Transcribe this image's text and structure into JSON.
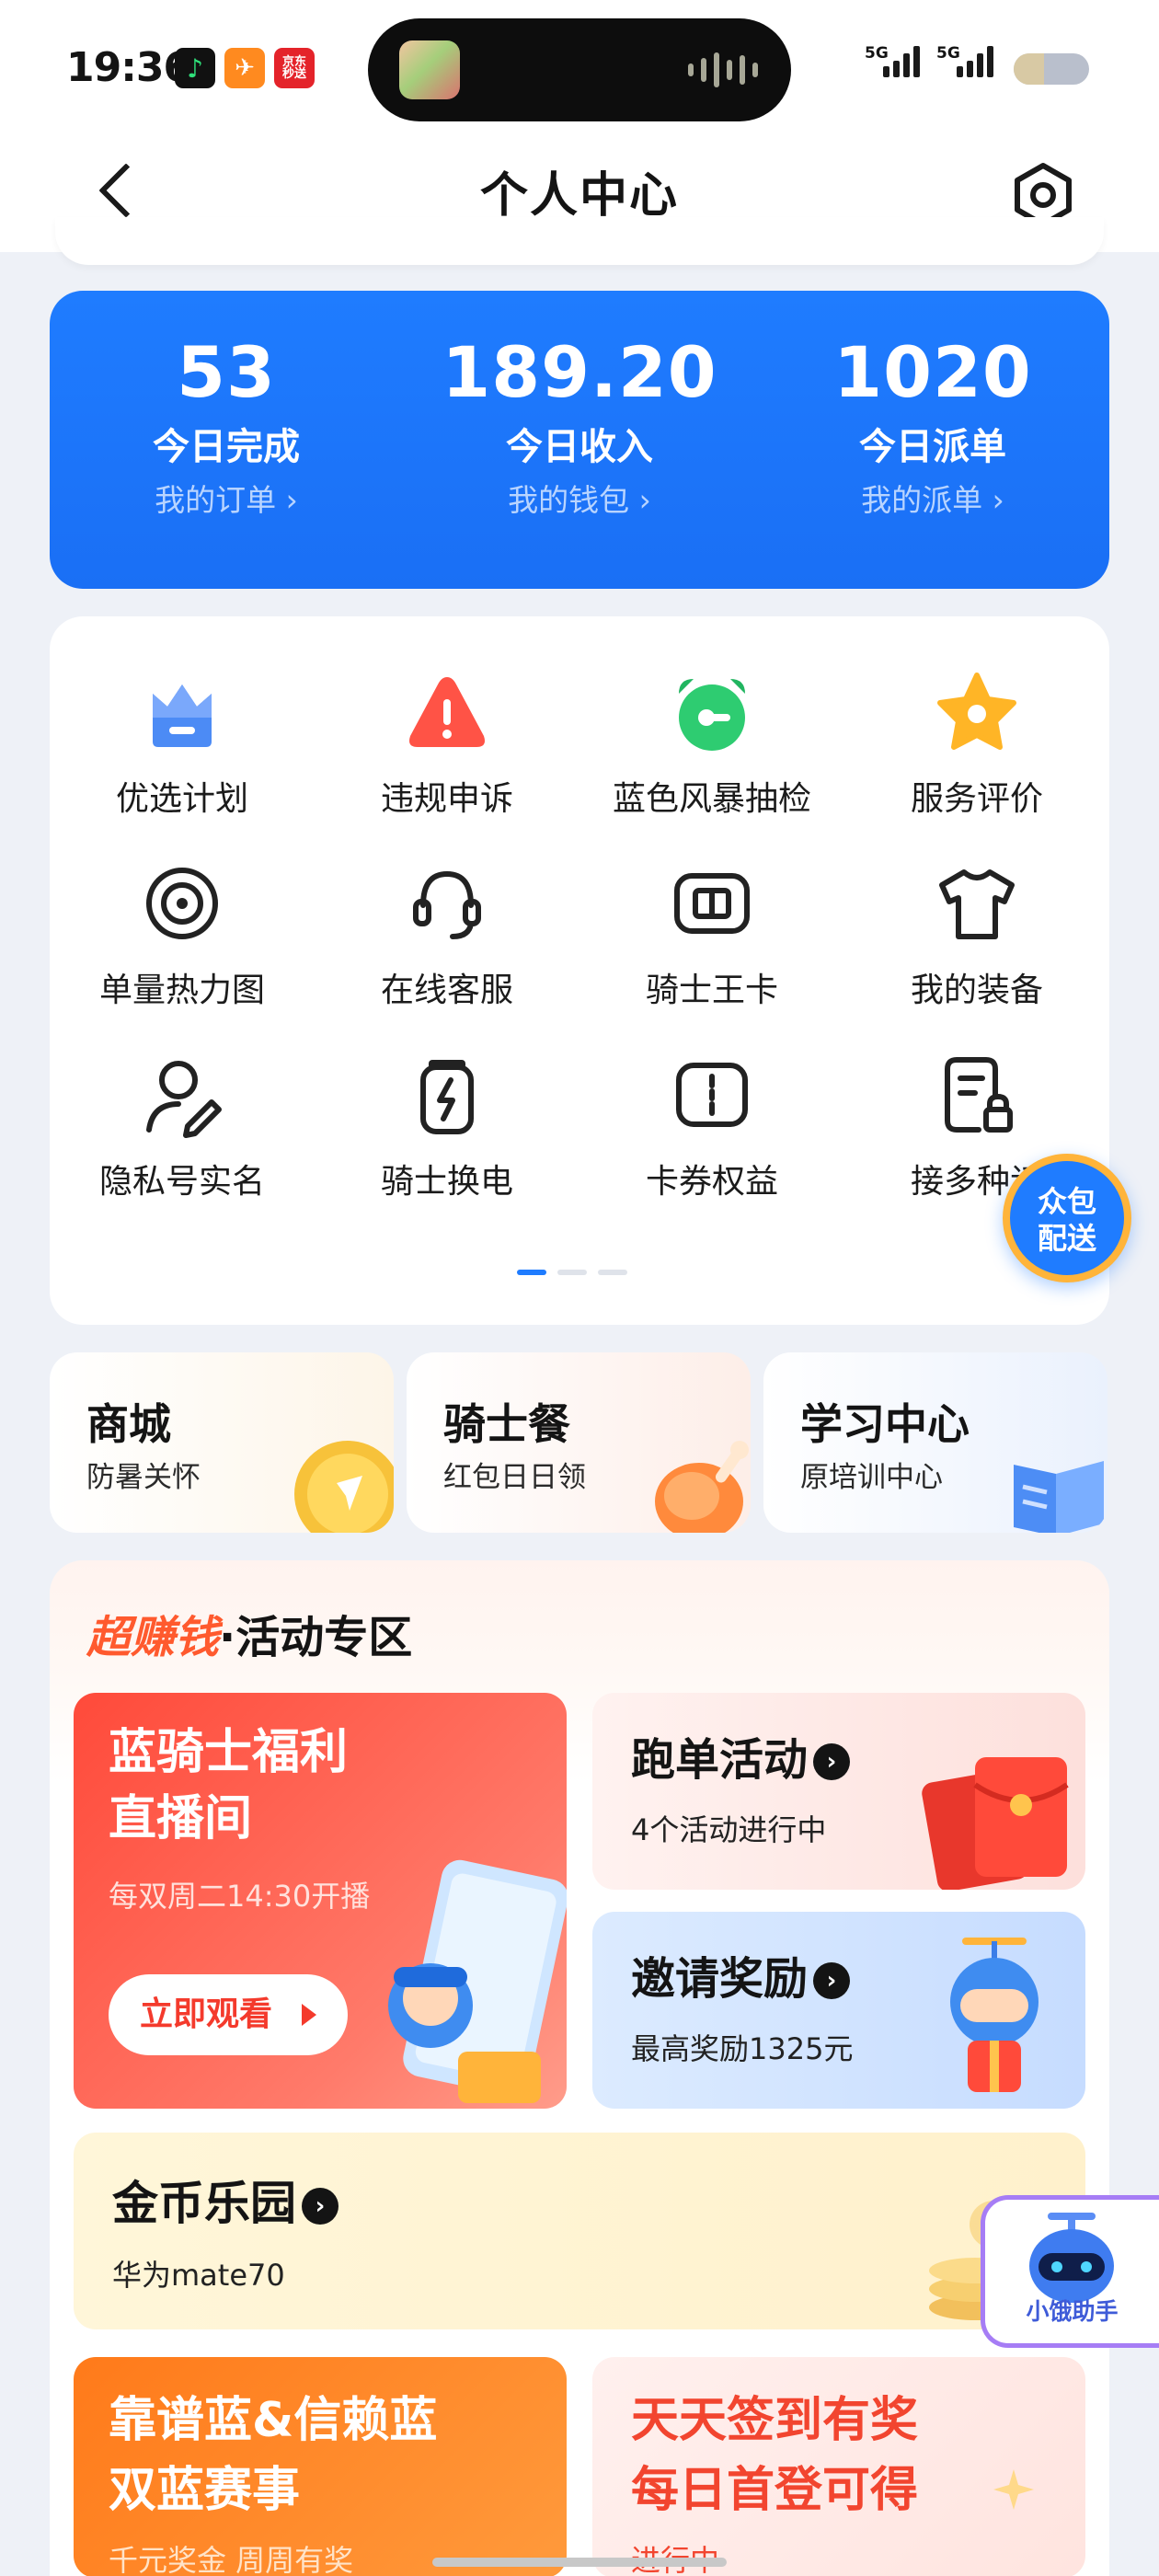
{
  "status_bar": {
    "time": "19:36",
    "apps": [
      {
        "name": "music-app-icon",
        "color": "#111111",
        "glyph": "♪"
      },
      {
        "name": "taobao-app-icon",
        "color": "#ff8a1f",
        "glyph": "✈"
      },
      {
        "name": "jd-app-icon",
        "color": "#e4232a",
        "glyph": "京东秒送"
      }
    ],
    "signal_1": "5G",
    "signal_2": "5G",
    "battery_level": 0.4
  },
  "header": {
    "title": "个人中心"
  },
  "stats": [
    {
      "value": "53",
      "label": "今日完成",
      "link": "我的订单 ›"
    },
    {
      "value": "189.20",
      "label": "今日收入",
      "link": "我的钱包 ›"
    },
    {
      "value": "1020",
      "label": "今日派单",
      "link": "我的派单 ›"
    }
  ],
  "services": [
    {
      "label": "优选计划",
      "icon": "crown-icon"
    },
    {
      "label": "违规申诉",
      "icon": "warning-icon"
    },
    {
      "label": "蓝色风暴抽检",
      "icon": "alarm-clock-icon"
    },
    {
      "label": "服务评价",
      "icon": "star-icon"
    },
    {
      "label": "单量热力图",
      "icon": "target-icon"
    },
    {
      "label": "在线客服",
      "icon": "headset-icon"
    },
    {
      "label": "骑士王卡",
      "icon": "sim-card-icon"
    },
    {
      "label": "我的装备",
      "icon": "tshirt-icon"
    },
    {
      "label": "隐私号实名",
      "icon": "user-edit-icon"
    },
    {
      "label": "骑士换电",
      "icon": "battery-swap-icon"
    },
    {
      "label": "卡券权益",
      "icon": "coupon-icon"
    },
    {
      "label": "接多种订",
      "icon": "order-types-icon"
    }
  ],
  "float_zhongbao": "众包\n配送",
  "quick_cards": [
    {
      "title": "商城",
      "sub": "防暑关怀"
    },
    {
      "title": "骑士餐",
      "sub": "红包日日领"
    },
    {
      "title": "学习中心",
      "sub": "原培训中心"
    }
  ],
  "activity": {
    "title_highlight": "超赚钱",
    "title_rest": "·活动专区",
    "live": {
      "title_line1": "蓝骑士福利",
      "title_line2": "直播间",
      "sub": "每双周二14:30开播",
      "button": "立即观看"
    },
    "run": {
      "title": "跑单活动",
      "sub": "4个活动进行中"
    },
    "invite": {
      "title": "邀请奖励",
      "sub": "最高奖励1325元"
    },
    "coins": {
      "title": "金币乐园",
      "sub": "华为mate70"
    },
    "contest": {
      "title_line1": "靠谱蓝&信赖蓝",
      "title_line2": "双蓝赛事",
      "sub": "千元奖金 周周有奖"
    },
    "checkin": {
      "title_line1": "天天签到有奖",
      "title_line2": "每日首登可得",
      "sub": "进行中"
    }
  },
  "float_xiaoe": "小饿助手"
}
